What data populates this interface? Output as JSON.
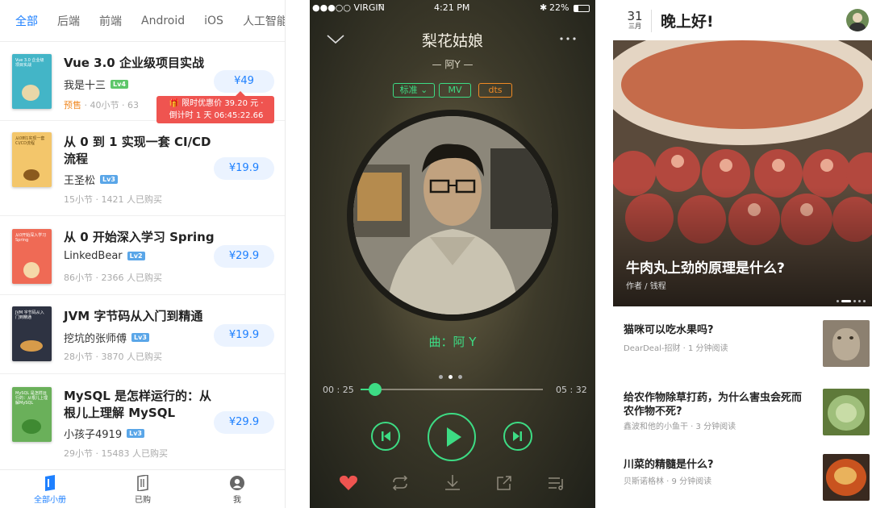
{
  "juejin": {
    "tabs": [
      "全部",
      "后端",
      "前端",
      "Android",
      "iOS",
      "人工智能"
    ],
    "books": [
      {
        "title": "Vue 3.0 企业级项目实战",
        "author": "我是十三",
        "level": "Lv4",
        "presale": "预售",
        "meta": "40小节 · 63",
        "price": "¥49",
        "cover_color": "#43b5c7",
        "cover_text": "Vue 3.0 企业级项目实战"
      },
      {
        "title": "从 0 到 1 实现一套 CI/CD 流程",
        "author": "王圣松",
        "level": "Lv3",
        "meta": "15小节 · 1421 人已购买",
        "price": "¥19.9",
        "cover_color": "#f3c66b",
        "cover_text": "从0到1实现一套CI/CD流程"
      },
      {
        "title": "从 0 开始深入学习 Spring",
        "author": "LinkedBear",
        "level": "Lv2",
        "meta": "86小节 · 2366 人已购买",
        "price": "¥29.9",
        "cover_color": "#ef6a55",
        "cover_text": "从0开始深入学习Spring"
      },
      {
        "title": "JVM 字节码从入门到精通",
        "author": "挖坑的张师傅",
        "level": "Lv3",
        "meta": "28小节 · 3870 人已购买",
        "price": "¥19.9",
        "cover_color": "#2e3342",
        "cover_text": "JVM 字节码从入门到精通"
      },
      {
        "title": "MySQL 是怎样运行的：从根儿上理解 MySQL",
        "author": "小孩子4919",
        "level": "Lv3",
        "meta": "29小节 · 15483 人已购买",
        "price": "¥29.9",
        "cover_color": "#6ab05a",
        "cover_text": "MySQL 是怎样运行的：从根儿上理解MySQL"
      }
    ],
    "tooltip_line1": "限时优惠价 39.20 元 ·",
    "tooltip_line2": "倒计时 1 天 06:45:22.66",
    "nav": [
      "全部小册",
      "已购",
      "我"
    ]
  },
  "music": {
    "carrier": "●●●○○ VIRGIN",
    "clock": "4:21 PM",
    "battery": "22%",
    "song": "梨花姑娘",
    "artist": "— 阿Y —",
    "tag_quality": "标准",
    "tag_mv": "MV",
    "tag_dts": "dts",
    "composer": "曲：阿 Y",
    "elapsed": "00 : 25",
    "total": "05 : 32",
    "progress": 0.08
  },
  "reading": {
    "day": "31",
    "month": "三月",
    "greeting": "晚上好!",
    "hero_title": "牛肉丸上劲的原理是什么?",
    "hero_author": "作者 / 钱程",
    "articles": [
      {
        "title": "猫咪可以吃水果吗?",
        "sub": "DearDeal-招财 · 1 分钟阅读"
      },
      {
        "title": "给农作物除草打药，为什么害虫会死而农作物不死?",
        "sub": "鑫波和他的小鱼干 · 3 分钟阅读"
      },
      {
        "title": "川菜的精髓是什么?",
        "sub": "贝斯诺格林 · 9 分钟阅读"
      }
    ]
  },
  "colors": {
    "accent_blue": "#1e80ff",
    "player_green": "#3ddc84",
    "promo_red": "#ef5450"
  }
}
